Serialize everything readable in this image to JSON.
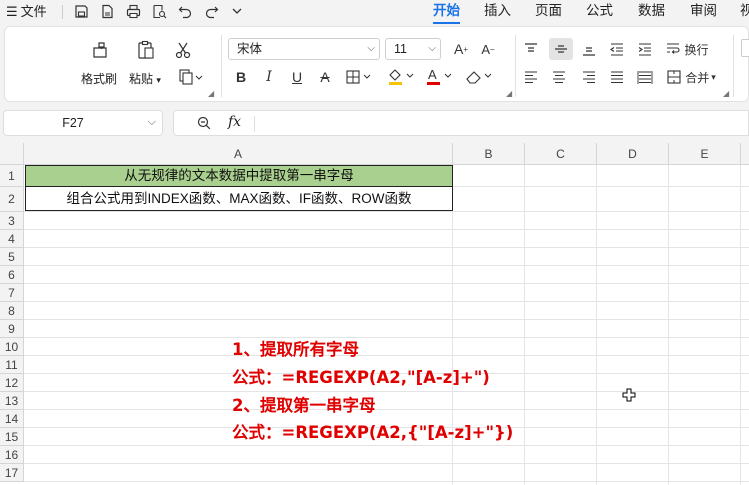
{
  "menu": {
    "file_label": "文件",
    "tabs": [
      "开始",
      "插入",
      "页面",
      "公式",
      "数据",
      "审阅",
      "视"
    ]
  },
  "ribbon": {
    "format_painter": "格式刷",
    "paste": "粘贴",
    "font_name": "宋体",
    "font_size": "11",
    "wrap_text": "换行",
    "merge": "合并"
  },
  "formula_bar": {
    "cell_ref": "F27",
    "fx_label": "fx",
    "formula": ""
  },
  "sheet": {
    "columns": [
      "A",
      "B",
      "C",
      "D",
      "E"
    ],
    "rows": [
      "1",
      "2",
      "3",
      "4",
      "5",
      "6",
      "7",
      "8",
      "9",
      "10",
      "11",
      "12",
      "13",
      "14",
      "15",
      "16",
      "17"
    ],
    "A1": "从无规律的文本数据中提取第一串字母",
    "A2": "组合公式用到INDEX函数、MAX函数、IF函数、ROW函数",
    "notes": [
      "1、提取所有字母",
      "公式：=REGEXP(A2,\"[A-z]+\")",
      "2、提取第一串字母",
      "公式：=REGEXP(A2,{\"[A-z]+\"})"
    ]
  },
  "colors": {
    "accent": "#1a73e8",
    "header_fill": "#a9d08e",
    "note_text": "#e00000"
  }
}
